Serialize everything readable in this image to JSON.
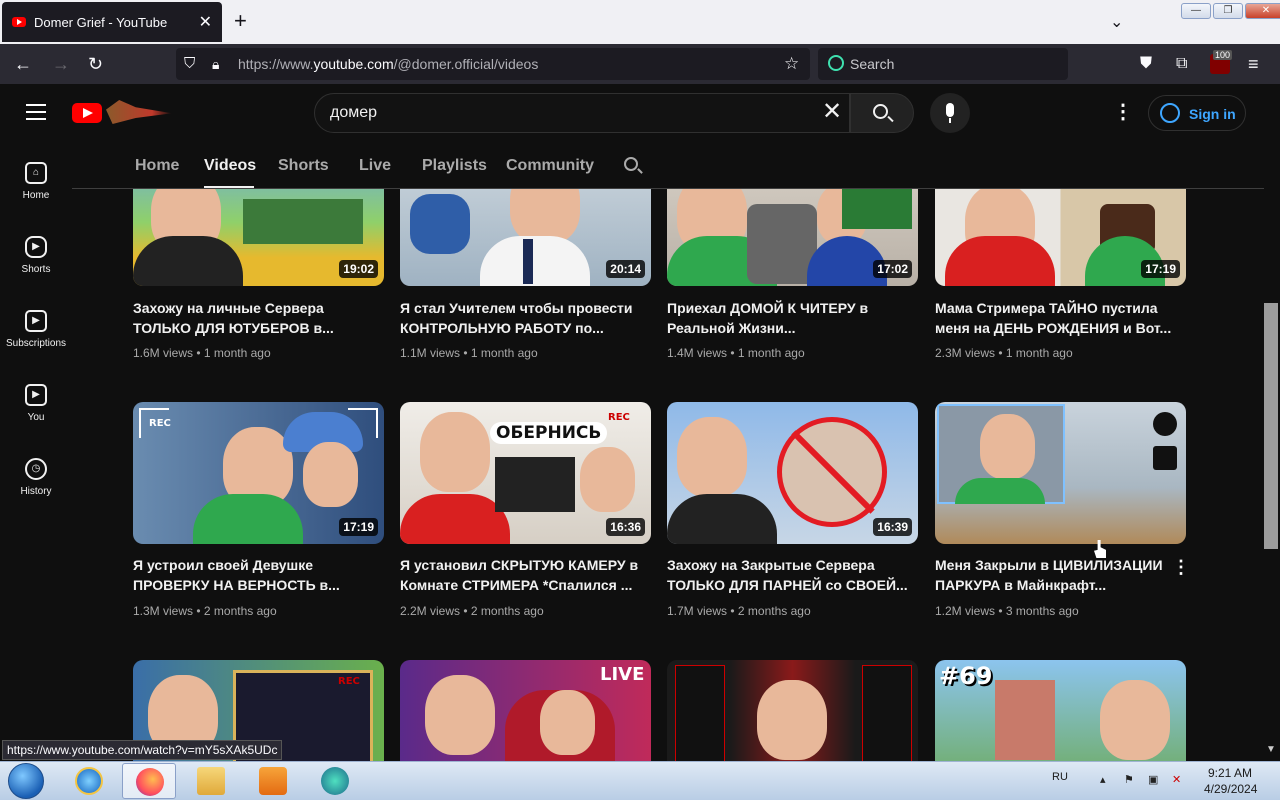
{
  "browser": {
    "tab_title": "Domer Grief - YouTube",
    "url_prefix": "https://www.",
    "url_host": "youtube.com",
    "url_path": "/@domer.official/videos",
    "search_placeholder": "Search",
    "ublock_count": "100",
    "status_url": "https://www.youtube.com/watch?v=mY5sXAk5UDc"
  },
  "yt": {
    "search_value": "домер",
    "sign_in": "Sign in",
    "guide": [
      {
        "label": "Home",
        "icon": "home-icon"
      },
      {
        "label": "Shorts",
        "icon": "shorts-icon"
      },
      {
        "label": "Subscriptions",
        "icon": "subscriptions-icon"
      },
      {
        "label": "You",
        "icon": "you-icon"
      },
      {
        "label": "History",
        "icon": "history-icon"
      }
    ],
    "tabs": [
      "Home",
      "Videos",
      "Shorts",
      "Live",
      "Playlists",
      "Community"
    ],
    "active_tab": "Videos"
  },
  "videos": [
    {
      "title": "Захожу на личные Сервера ТОЛЬКО ДЛЯ ЮТУБЕРОВ в...",
      "views": "1.6M views",
      "age": "1 month ago",
      "duration": "19:02"
    },
    {
      "title": "Я стал Учителем чтобы провести КОНТРОЛЬНУЮ РАБОТУ по...",
      "views": "1.1M views",
      "age": "1 month ago",
      "duration": "20:14"
    },
    {
      "title": "Приехал ДОМОЙ К ЧИТЕРУ в Реальной Жизни...",
      "views": "1.4M views",
      "age": "1 month ago",
      "duration": "17:02"
    },
    {
      "title": "Мама Стримера ТАЙНО пустила меня на ДЕНЬ РОЖДЕНИЯ и Вот...",
      "views": "2.3M views",
      "age": "1 month ago",
      "duration": "17:19"
    },
    {
      "title": "Я устроил своей Девушке ПРОВЕРКУ НА ВЕРНОСТЬ в...",
      "views": "1.3M views",
      "age": "2 months ago",
      "duration": "17:19",
      "overlay": "REC"
    },
    {
      "title": "Я установил СКРЫТУЮ КАМЕРУ в Комнате СТРИМЕРА *Спалился ...",
      "views": "2.2M views",
      "age": "2 months ago",
      "duration": "16:36",
      "overlay": "ОБЕРНИСЬ",
      "overlay2": "REC"
    },
    {
      "title": "Захожу на Закрытые Сервера ТОЛЬКО ДЛЯ ПАРНЕЙ со СВОЕЙ...",
      "views": "1.7M views",
      "age": "2 months ago",
      "duration": "16:39"
    },
    {
      "title": "Меня Закрыли в ЦИВИЛИЗАЦИИ ПАРКУРА в Майнкрафт...",
      "views": "1.2M views",
      "age": "3 months ago",
      "duration": ""
    },
    {
      "title": "",
      "views": "",
      "age": "",
      "duration": "",
      "overlay": "REC"
    },
    {
      "title": "",
      "views": "",
      "age": "",
      "duration": "",
      "overlay": "LIVE"
    },
    {
      "title": "",
      "views": "",
      "age": "",
      "duration": ""
    },
    {
      "title": "",
      "views": "",
      "age": "",
      "duration": "",
      "overlay": "#69"
    }
  ],
  "taskbar": {
    "lang": "RU",
    "time": "9:21 AM",
    "date": "4/29/2024"
  }
}
